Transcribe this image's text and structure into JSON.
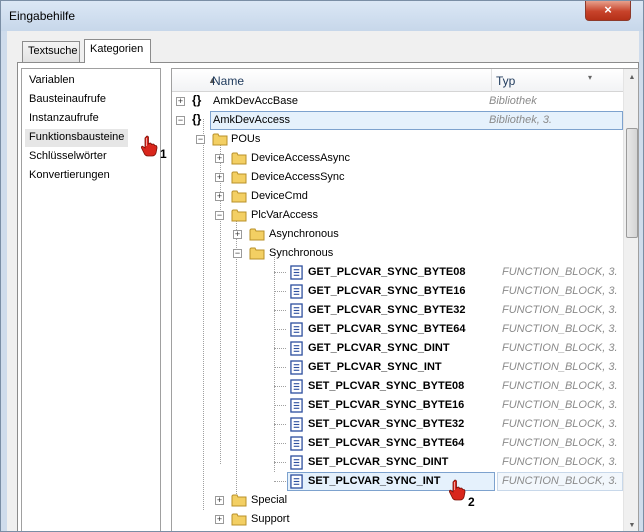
{
  "window": {
    "title": "Eingabehilfe",
    "close_glyph": "×"
  },
  "tabs": [
    {
      "label": "Textsuche"
    },
    {
      "label": "Kategorien"
    }
  ],
  "categories": [
    {
      "label": "Variablen"
    },
    {
      "label": "Bausteinaufrufe"
    },
    {
      "label": "Instanzaufrufe"
    },
    {
      "label": "Funktionsbausteine"
    },
    {
      "label": "Schlüsselwörter"
    },
    {
      "label": "Konvertierungen"
    }
  ],
  "tree": {
    "columns": {
      "name": "Name",
      "type": "Typ"
    },
    "rows": [
      {
        "label": "AmkDevAccBase",
        "type": "Bibliothek",
        "icon": "library-icon"
      },
      {
        "label": "AmkDevAccess",
        "type": "Bibliothek",
        "type_suffix": ", 3.",
        "icon": "library-icon"
      },
      {
        "label": "POUs",
        "icon": "folder-icon"
      },
      {
        "label": "DeviceAccessAsync",
        "icon": "folder-icon"
      },
      {
        "label": "DeviceAccessSync",
        "icon": "folder-icon"
      },
      {
        "label": "DeviceCmd",
        "icon": "folder-icon"
      },
      {
        "label": "PlcVarAccess",
        "icon": "folder-icon"
      },
      {
        "label": "Asynchronous",
        "icon": "folder-icon"
      },
      {
        "label": "Synchronous",
        "icon": "folder-icon"
      },
      {
        "label": "GET_PLCVAR_SYNC_BYTE08",
        "type": "FUNCTION_BLOCK, 3.",
        "icon": "function-block-icon"
      },
      {
        "label": "GET_PLCVAR_SYNC_BYTE16",
        "type": "FUNCTION_BLOCK, 3.",
        "icon": "function-block-icon"
      },
      {
        "label": "GET_PLCVAR_SYNC_BYTE32",
        "type": "FUNCTION_BLOCK, 3.",
        "icon": "function-block-icon"
      },
      {
        "label": "GET_PLCVAR_SYNC_BYTE64",
        "type": "FUNCTION_BLOCK, 3.",
        "icon": "function-block-icon"
      },
      {
        "label": "GET_PLCVAR_SYNC_DINT",
        "type": "FUNCTION_BLOCK, 3.",
        "icon": "function-block-icon"
      },
      {
        "label": "GET_PLCVAR_SYNC_INT",
        "type": "FUNCTION_BLOCK, 3.",
        "icon": "function-block-icon"
      },
      {
        "label": "SET_PLCVAR_SYNC_BYTE08",
        "type": "FUNCTION_BLOCK, 3.",
        "icon": "function-block-icon"
      },
      {
        "label": "SET_PLCVAR_SYNC_BYTE16",
        "type": "FUNCTION_BLOCK, 3.",
        "icon": "function-block-icon"
      },
      {
        "label": "SET_PLCVAR_SYNC_BYTE32",
        "type": "FUNCTION_BLOCK, 3.",
        "icon": "function-block-icon"
      },
      {
        "label": "SET_PLCVAR_SYNC_BYTE64",
        "type": "FUNCTION_BLOCK, 3.",
        "icon": "function-block-icon"
      },
      {
        "label": "SET_PLCVAR_SYNC_DINT",
        "type": "FUNCTION_BLOCK, 3.",
        "icon": "function-block-icon"
      },
      {
        "label": "SET_PLCVAR_SYNC_INT",
        "type": "FUNCTION_BLOCK, 3.",
        "icon": "function-block-icon"
      },
      {
        "label": "Special",
        "icon": "folder-icon"
      },
      {
        "label": "Support",
        "icon": "folder-icon"
      }
    ]
  },
  "annotations": {
    "step1": "1",
    "step2": "2"
  },
  "colors": {
    "selection": "#dce9f7",
    "selection_border": "#7da2ce",
    "type_text": "#8a8a8a",
    "hand_red": "#d9261c"
  }
}
